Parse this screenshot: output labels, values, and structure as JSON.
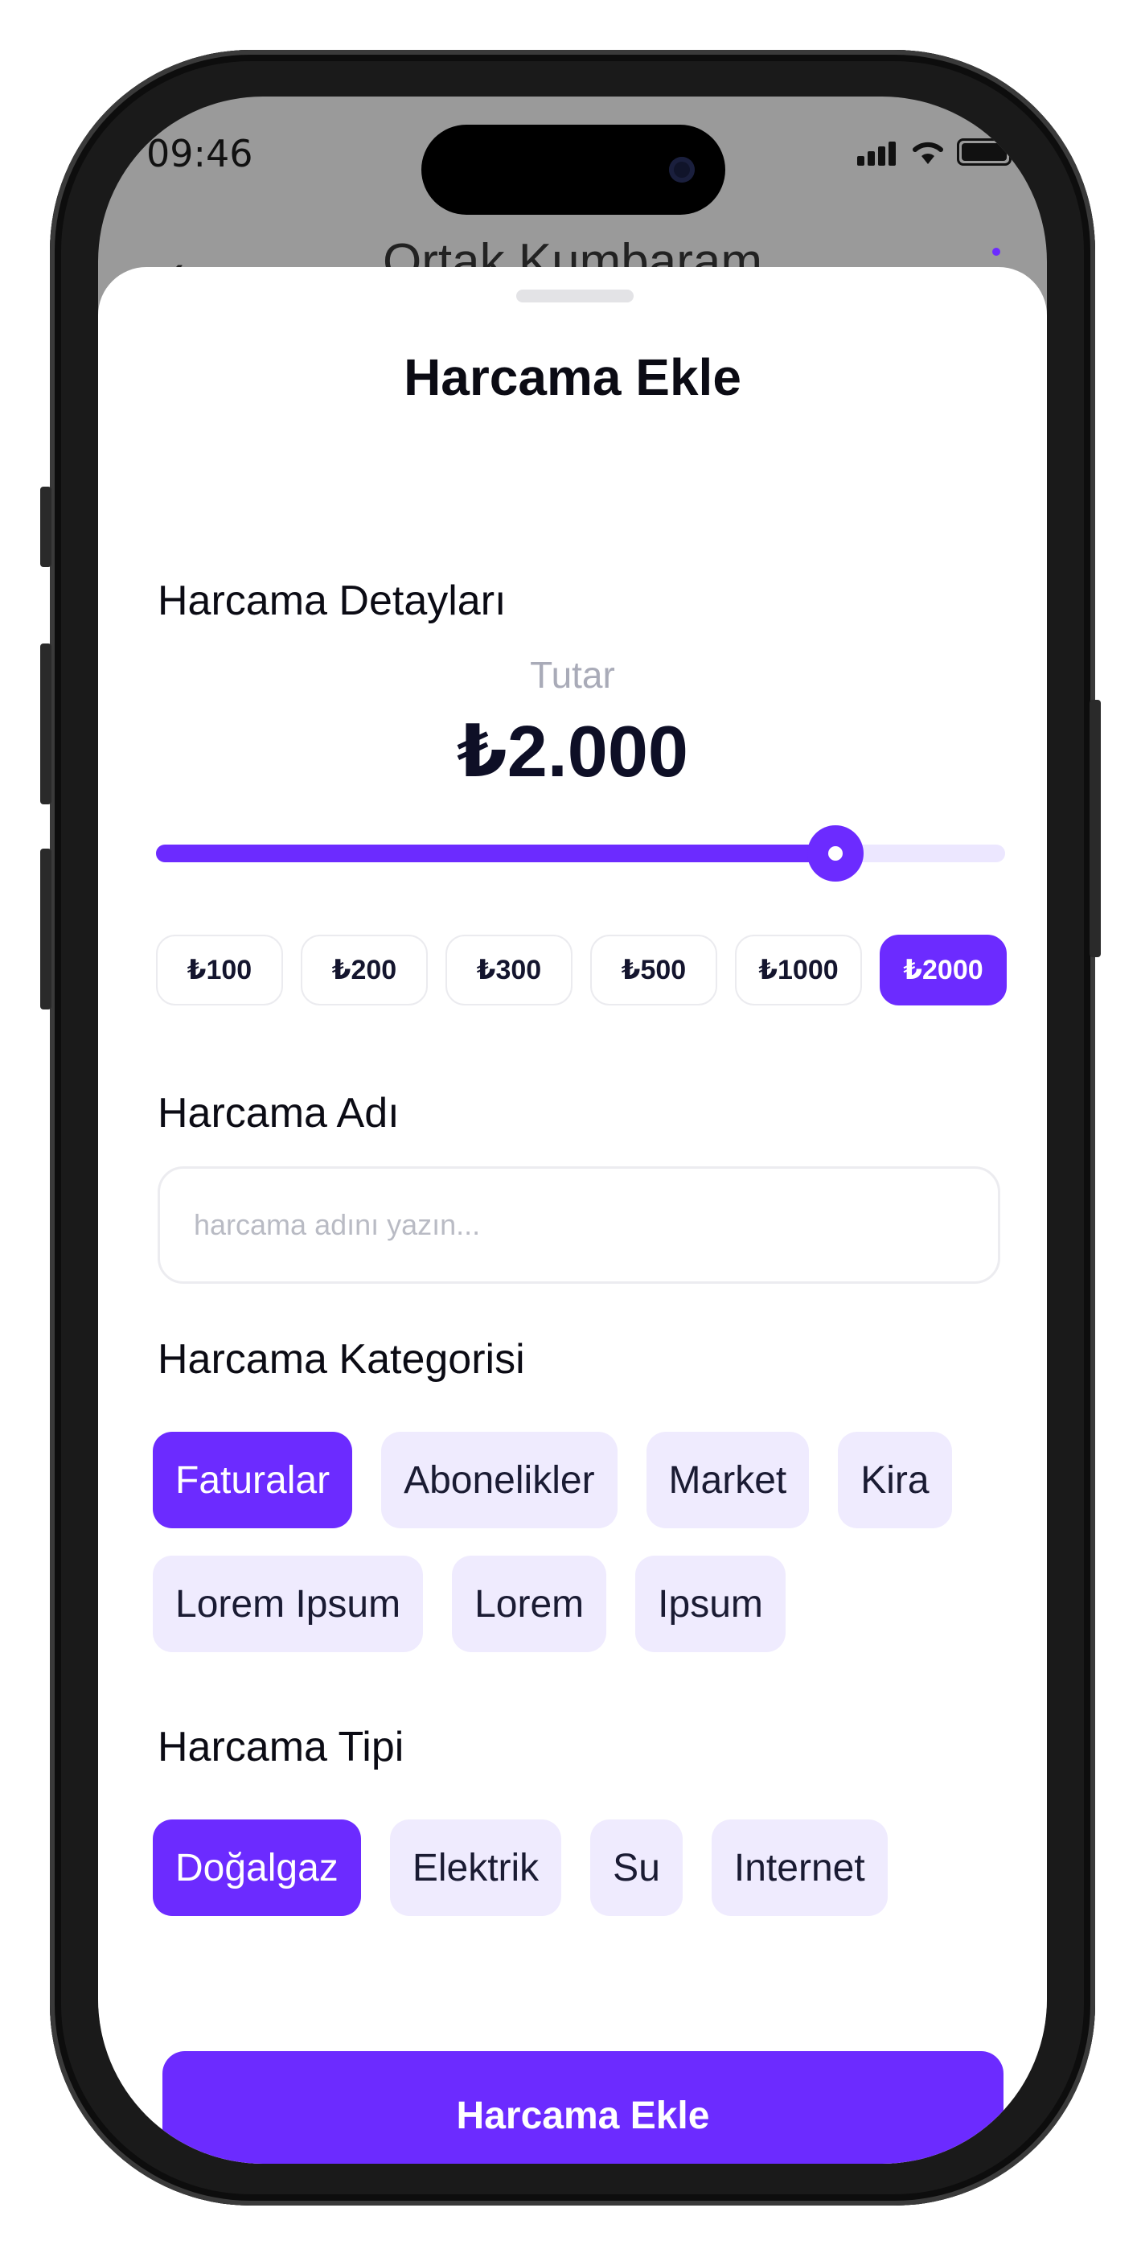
{
  "status_bar": {
    "time": "09:46"
  },
  "underlay": {
    "back_icon": "chevron-left-icon",
    "title": "Ortak Kumbaram",
    "menu_icon": "more-vertical-icon"
  },
  "sheet": {
    "title": "Harcama Ekle",
    "details": {
      "section_title": "Harcama Detayları",
      "amount_label": "Tutar",
      "amount_value": "₺2.000",
      "slider_fraction": 0.8,
      "presets": [
        {
          "label": "₺100",
          "active": false
        },
        {
          "label": "₺200",
          "active": false
        },
        {
          "label": "₺300",
          "active": false
        },
        {
          "label": "₺500",
          "active": false
        },
        {
          "label": "₺1000",
          "active": false
        },
        {
          "label": "₺2000",
          "active": true
        }
      ]
    },
    "name": {
      "section_title": "Harcama Adı",
      "value": "",
      "placeholder": "harcama adını yazın..."
    },
    "category": {
      "section_title": "Harcama Kategorisi",
      "chips": [
        {
          "label": "Faturalar",
          "active": true
        },
        {
          "label": "Abonelikler",
          "active": false
        },
        {
          "label": "Market",
          "active": false
        },
        {
          "label": "Kira",
          "active": false
        },
        {
          "label": "Lorem Ipsum",
          "active": false
        },
        {
          "label": "Lorem",
          "active": false
        },
        {
          "label": "Ipsum",
          "active": false
        }
      ]
    },
    "type": {
      "section_title": "Harcama Tipi",
      "chips": [
        {
          "label": "Doğalgaz",
          "active": true
        },
        {
          "label": "Elektrik",
          "active": false
        },
        {
          "label": "Su",
          "active": false
        },
        {
          "label": "Internet",
          "active": false
        }
      ]
    },
    "submit_label": "Harcama Ekle"
  },
  "colors": {
    "accent": "#6C2BFF",
    "chip_bg": "#EFEBFE",
    "slider_track": "#ECE7FF",
    "text_dark": "#0E0F26"
  }
}
